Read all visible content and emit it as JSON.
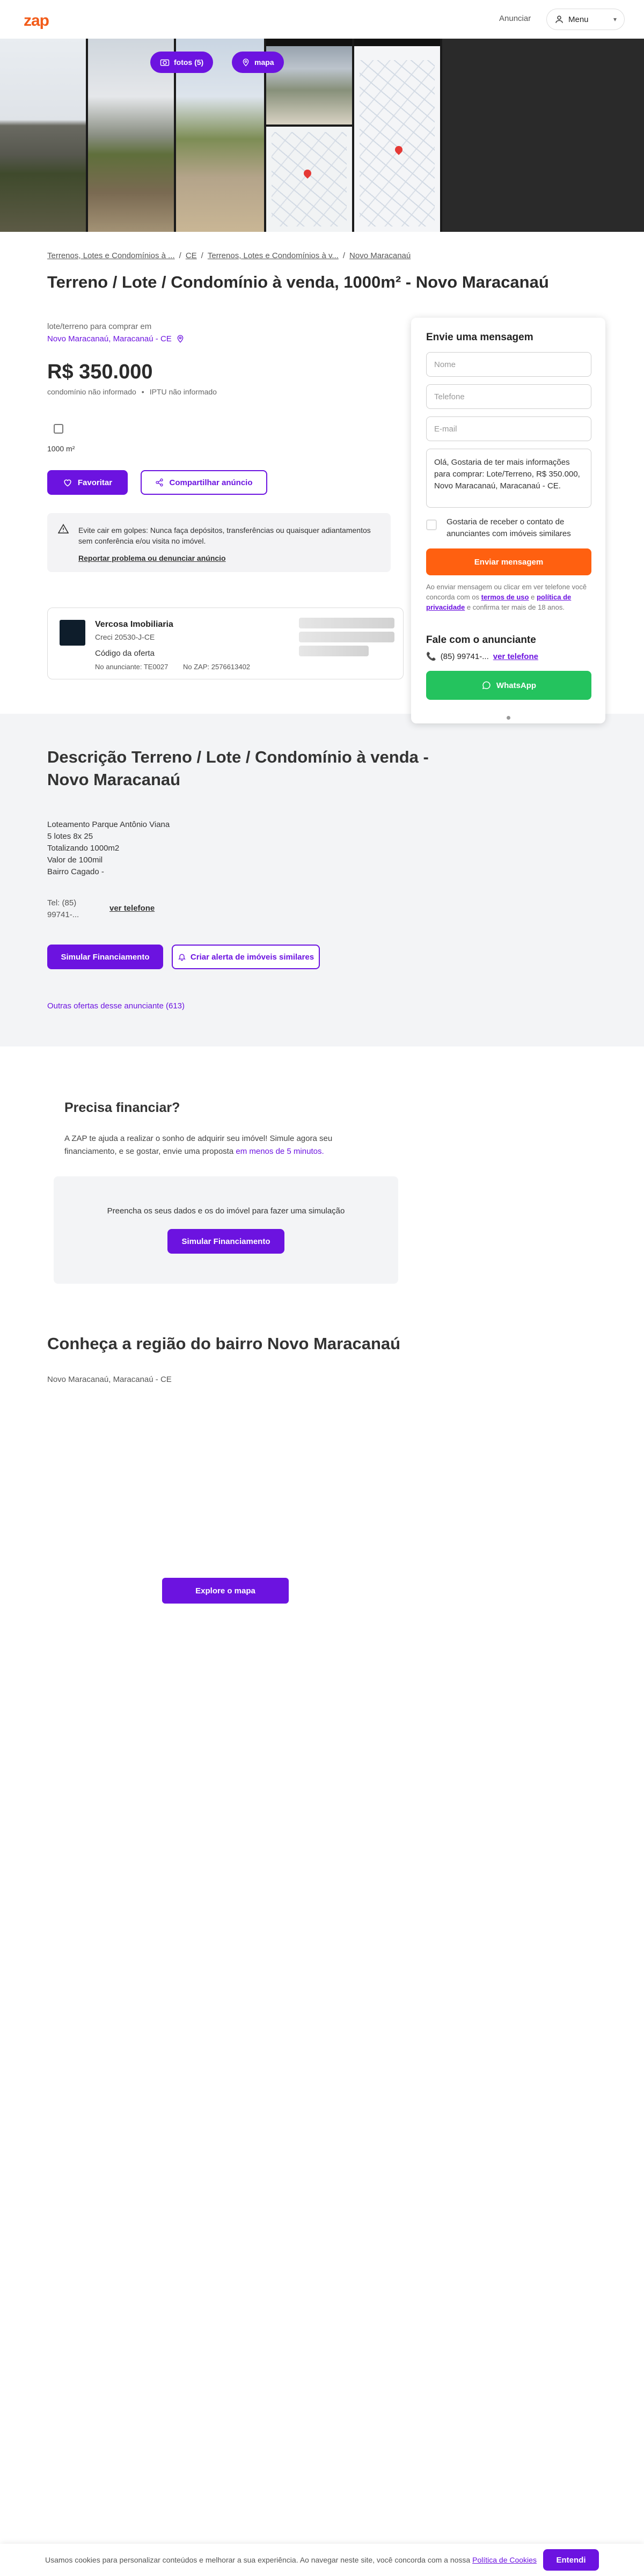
{
  "brand": {
    "logo": "zap",
    "accent_color": "#6c13e0",
    "logo_color": "#f25c1a",
    "cta_orange": "#ff6010",
    "whatsapp_green": "#24c35e"
  },
  "header": {
    "announce_link": "Anunciar",
    "menu_label": "Menu",
    "menu_icon": "user-icon"
  },
  "gallery": {
    "photos_button": "fotos (5)",
    "map_button": "mapa"
  },
  "breadcrumb": [
    "Terrenos, Lotes e Condomínios à ...",
    "CE",
    "Terrenos, Lotes e Condomínios à v...",
    "Novo Maracanaú"
  ],
  "listing": {
    "title": "Terreno / Lote / Condomínio à venda, 1000m² - Novo Maracanaú",
    "subtitle": "lote/terreno para comprar em",
    "location": "Novo Maracanaú, Maracanaú - CE",
    "price": "R$ 350.000",
    "condo_fee": "condomínio não informado",
    "iptu": "IPTU não informado",
    "area": "1000 m²",
    "favorite_button": "Favoritar",
    "share_button": "Compartilhar anúncio"
  },
  "alert": {
    "text": "Evite cair em golpes: Nunca faça depósitos, transferências ou quaisquer adiantamentos sem conferência e/ou visita no imóvel.",
    "report_link": "Reportar problema ou denunciar anúncio"
  },
  "advertiser": {
    "name": "Vercosa Imobiliaria",
    "creci": "Creci 20530-J-CE",
    "code_label": "Código da oferta",
    "code_advertiser": "No anunciante: TE0027",
    "code_zap": "No ZAP: 2576613402"
  },
  "contact_form": {
    "title": "Envie uma mensagem",
    "name_placeholder": "Nome",
    "phone_placeholder": "Telefone",
    "email_placeholder": "E-mail",
    "message": "Olá, Gostaria de ter mais informações para comprar: Lote/Terreno, R$ 350.000, Novo Maracanaú, Maracanaú - CE.",
    "similar_checkbox": "Gostaria de receber o contato de anunciantes com imóveis similares",
    "send_button": "Enviar mensagem",
    "terms_prefix": "Ao enviar mensagem ou clicar em ver telefone você concorda com os",
    "terms_link": "termos de uso",
    "terms_and": "e",
    "privacy_link": "política de privacidade",
    "terms_suffix": "e confirma ter mais de 18 anos.",
    "talk_title": "Fale com o anunciante",
    "phone_partial": "(85) 99741-...",
    "see_phone": "ver telefone",
    "whatsapp_button": "WhatsApp"
  },
  "description": {
    "title": "Descrição Terreno / Lote / Condomínio à venda - Novo Maracanaú",
    "lines": [
      "Loteamento Parque Antônio Viana",
      "5 lotes 8x 25",
      "Totalizando 1000m2",
      "Valor de 100mil",
      "Bairro Cagado -"
    ],
    "tel_partial_1": "Tel: (85)",
    "tel_partial_2": "99741-...",
    "see_phone": "ver telefone",
    "simulate_button": "Simular Financiamento",
    "alert_button": "Criar alerta de imóveis similares",
    "other_offers": "Outras ofertas desse anunciante (613)"
  },
  "financing": {
    "title": "Precisa financiar?",
    "text": "A ZAP te ajuda a realizar o sonho de adquirir seu imóvel! Simule agora seu financiamento, e se gostar, envie uma proposta",
    "text_link": "em menos de 5 minutos.",
    "box_text": "Preencha os seus dados e os do imóvel para fazer uma simulação",
    "button": "Simular Financiamento"
  },
  "region": {
    "title": "Conheça a região do bairro Novo Maracanaú",
    "subtitle": "Novo Maracanaú, Maracanaú - CE",
    "map_button": "Explore o mapa"
  },
  "cookie": {
    "text": "Usamos cookies para personalizar conteúdos e melhorar a sua experiência. Ao navegar neste site, você concorda com a nossa",
    "link": "Política de Cookies",
    "button": "Entendi"
  }
}
